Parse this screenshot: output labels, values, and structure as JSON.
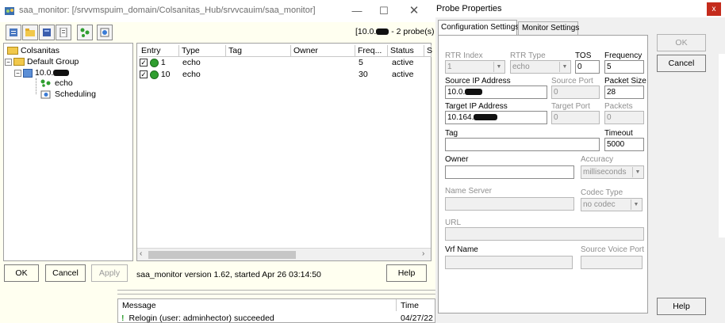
{
  "main_window": {
    "title": "saa_monitor: [/srvvmspuim_domain/Colsanitas_Hub/srvvcauim/saa_monitor]",
    "probe_count": "[10.0.",
    "probe_count_suffix": "- 2  probe(s)",
    "tree": {
      "root": "Colsanitas",
      "group": "Default Group",
      "host": "10.0.",
      "children": [
        "echo",
        "Scheduling"
      ]
    },
    "grid": {
      "columns": [
        "Entry",
        "Type",
        "Tag",
        "Owner",
        "Freq...",
        "Status",
        "S"
      ],
      "rows": [
        {
          "entry": "1",
          "type": "echo",
          "tag": "",
          "owner": "",
          "freq": "5",
          "status": "active"
        },
        {
          "entry": "10",
          "type": "echo",
          "tag": "",
          "owner": "",
          "freq": "30",
          "status": "active"
        }
      ]
    },
    "buttons": {
      "ok": "OK",
      "cancel": "Cancel",
      "apply": "Apply",
      "help": "Help"
    },
    "status_text": "saa_monitor version 1.62, started Apr 26 03:14:50",
    "log": {
      "col_message": "Message",
      "col_time": "Time",
      "row_message": "Relogin (user: adminhector) succeeded",
      "row_time": "04/27/22"
    }
  },
  "dialog": {
    "title": "Probe Properties",
    "tabs": [
      "Configuration Settings",
      "Monitor Settings"
    ],
    "buttons": {
      "ok": "OK",
      "cancel": "Cancel",
      "help": "Help"
    },
    "fields": {
      "rtr_index": {
        "label": "RTR Index",
        "value": "1"
      },
      "rtr_type": {
        "label": "RTR Type",
        "value": "echo"
      },
      "tos": {
        "label": "TOS",
        "value": "0"
      },
      "frequency": {
        "label": "Frequency",
        "value": "5"
      },
      "source_ip": {
        "label": "Source IP Address",
        "value": "10.0."
      },
      "source_port": {
        "label": "Source Port",
        "value": "0"
      },
      "packet_size": {
        "label": "Packet Size",
        "value": "28"
      },
      "target_ip": {
        "label": "Target IP Address",
        "value": "10.164."
      },
      "target_port": {
        "label": "Target Port",
        "value": "0"
      },
      "packets": {
        "label": "Packets",
        "value": "0"
      },
      "tag": {
        "label": "Tag",
        "value": ""
      },
      "timeout": {
        "label": "Timeout",
        "value": "5000"
      },
      "owner": {
        "label": "Owner",
        "value": ""
      },
      "accuracy": {
        "label": "Accuracy",
        "value": "milliseconds"
      },
      "name_server": {
        "label": "Name Server",
        "value": ""
      },
      "codec_type": {
        "label": "Codec Type",
        "value": "no codec"
      },
      "url": {
        "label": "URL",
        "value": ""
      },
      "vrf_name": {
        "label": "Vrf Name",
        "value": ""
      },
      "source_voice_port": {
        "label": "Source Voice Port",
        "value": ""
      }
    }
  },
  "colors": {
    "accent_green": "#2f9e2f",
    "close_red": "#c42b1c",
    "window_bg": "#fffff0",
    "dialog_bg": "#f0f0f0"
  }
}
